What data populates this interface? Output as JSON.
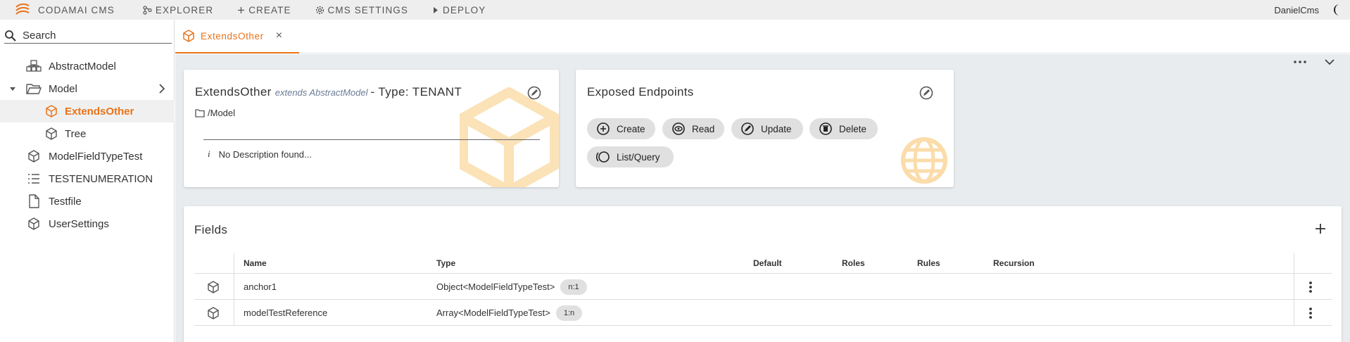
{
  "topbar": {
    "brand": "CODAMAI CMS",
    "nav": [
      {
        "icon": "explorer-icon",
        "label": "EXPLORER"
      },
      {
        "icon": "plus-icon",
        "label": "CREATE"
      },
      {
        "icon": "gear-icon",
        "label": "CMS SETTINGS"
      },
      {
        "icon": "play-icon",
        "label": "DEPLOY"
      }
    ],
    "user": "DanielCms",
    "theme_icon": "moon-icon"
  },
  "sidebar": {
    "search_placeholder": "Search",
    "items": [
      {
        "label": "AbstractModel",
        "icon": "abstract-model-icon"
      },
      {
        "label": "Model",
        "icon": "folder-open-icon",
        "expanded": true
      },
      {
        "label": "ExtendsOther",
        "icon": "cube-icon",
        "active": true
      },
      {
        "label": "Tree",
        "icon": "cube-icon"
      },
      {
        "label": "ModelFieldTypeTest",
        "icon": "cube-icon"
      },
      {
        "label": "TESTENUMERATION",
        "icon": "list-icon"
      },
      {
        "label": "Testfile",
        "icon": "file-icon"
      },
      {
        "label": "UserSettings",
        "icon": "cube-icon"
      }
    ]
  },
  "tabs": [
    {
      "label": "ExtendsOther",
      "icon": "cube-icon",
      "close": "×"
    }
  ],
  "model_card": {
    "name": "ExtendsOther",
    "extends": "extends AbstractModel",
    "type_text": "- Type: TENANT",
    "path": "/Model",
    "description": "No Description found...",
    "info_glyph": "i"
  },
  "endpoints_card": {
    "title": "Exposed Endpoints",
    "endpoints": [
      "Create",
      "Read",
      "Update",
      "Delete",
      "List/Query"
    ]
  },
  "fields_card": {
    "title": "Fields",
    "columns": [
      "Name",
      "Type",
      "Default",
      "Roles",
      "Rules",
      "Recursion"
    ],
    "rows": [
      {
        "name": "anchor1",
        "type": "Object<ModelFieldTypeTest>",
        "relation": "n:1"
      },
      {
        "name": "modelTestReference",
        "type": "Array<ModelFieldTypeTest>",
        "relation": "1:n"
      }
    ]
  },
  "colors": {
    "accent": "#e8731a",
    "content_bg": "#e9ecef",
    "chip_bg": "#e0e0e0"
  }
}
